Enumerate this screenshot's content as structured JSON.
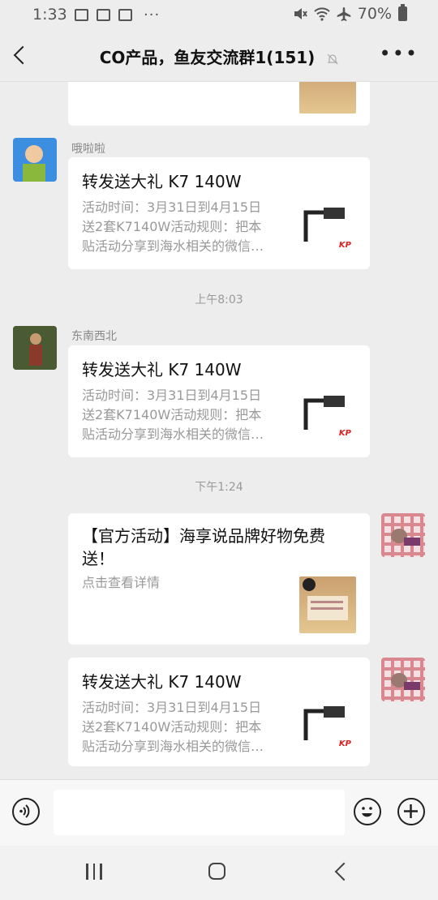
{
  "status_bar": {
    "time": "1:33",
    "battery": "70%"
  },
  "header": {
    "title": "CO产品，鱼友交流群1(151)"
  },
  "messages": [
    {
      "sender": "哦啦啦",
      "title": "转发送大礼 K7 140W",
      "desc_lines": [
        "活动时间：3月31日到4月15日",
        "送2套K7140W活动规则：把本",
        "贴活动分享到海水相关的微信…"
      ]
    },
    {
      "sender": "东南西北",
      "title": "转发送大礼 K7 140W",
      "desc_lines": [
        "活动时间：3月31日到4月15日",
        "送2套K7140W活动规则：把本",
        "贴活动分享到海水相关的微信…"
      ]
    },
    {
      "sender": "",
      "title_lines": [
        "【官方活动】海享说品牌好物免费",
        "送！"
      ],
      "desc_lines": [
        "点击查看详情"
      ]
    },
    {
      "sender": "",
      "title": "转发送大礼 K7 140W",
      "desc_lines": [
        "活动时间：3月31日到4月15日",
        "送2套K7140W活动规则：把本",
        "贴活动分享到海水相关的微信…"
      ]
    }
  ],
  "timestamps": [
    "上午8:03",
    "下午1:24"
  ],
  "thumb_brand": "KP",
  "colors": {
    "background": "#ededed",
    "card": "#ffffff",
    "muted_text": "#999999"
  },
  "icons": {
    "voice": "voice-icon",
    "emoji": "emoji-icon",
    "plus": "plus-icon",
    "back": "back-arrow-icon",
    "more": "more-icon",
    "mute": "mute-bell-icon"
  }
}
